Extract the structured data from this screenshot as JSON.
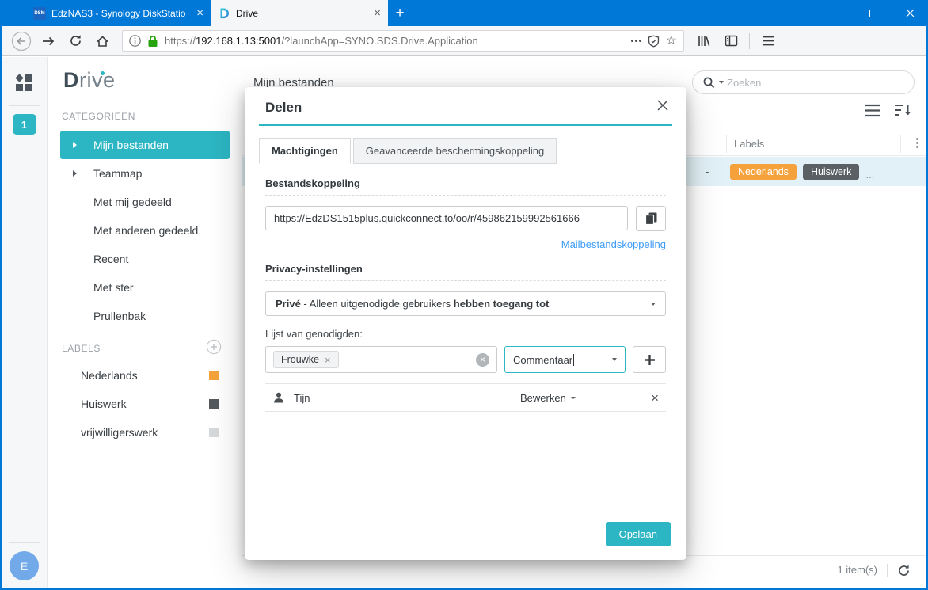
{
  "browser": {
    "tabs": [
      {
        "favicon_text": "DSM",
        "title": "EdzNAS3 - Synology DiskStatio",
        "close": "×"
      },
      {
        "title": "Drive",
        "close": "×"
      }
    ],
    "new_tab_label": "+",
    "url": {
      "scheme": "https://",
      "host": "192.168.1.13:5001",
      "path": "/?launchApp=SYNO.SDS.Drive.Application"
    }
  },
  "rail": {
    "badge_count": "1",
    "avatar_initial": "E"
  },
  "sidebar": {
    "logo_d": "D",
    "logo_rest": "rive",
    "categories_header": "CATEGORIEËN",
    "items": [
      {
        "label": "Mijn bestanden"
      },
      {
        "label": "Teammap"
      },
      {
        "label": "Met mij gedeeld"
      },
      {
        "label": "Met anderen gedeeld"
      },
      {
        "label": "Recent"
      },
      {
        "label": "Met ster"
      },
      {
        "label": "Prullenbak"
      }
    ],
    "labels_header": "LABELS",
    "labels": [
      {
        "name": "Nederlands",
        "color": "#F5A23C"
      },
      {
        "name": "Huiswerk",
        "color": "#54595E"
      },
      {
        "name": "vrijwilligerswerk",
        "color": "#D6D9DB"
      }
    ]
  },
  "content": {
    "page_title": "Mijn bestanden",
    "search_placeholder": "Zoeken",
    "table": {
      "labels_column_header": "Labels",
      "row": {
        "dash": "-",
        "tags": [
          {
            "name": "Nederlands",
            "bg": "#F5A23C"
          },
          {
            "name": "Huiswerk",
            "bg": "#5B6064"
          }
        ],
        "ellipsis": "..."
      }
    },
    "status_count": "1 item(s)"
  },
  "dialog": {
    "title": "Delen",
    "tabs": [
      {
        "label": "Machtigingen"
      },
      {
        "label": "Geavanceerde beschermingskoppeling"
      }
    ],
    "file_link": {
      "section_title": "Bestandskoppeling",
      "value": "https://EdzDS1515plus.quickconnect.to/oo/r/459862159992561666",
      "mail_link_label": "Mailbestandskoppeling"
    },
    "privacy": {
      "section_title": "Privacy-instellingen",
      "value_bold_start": "Privé",
      "value_middle": " - Alleen uitgenodigde gebruikers ",
      "value_bold_end": "hebben toegang tot"
    },
    "invitees": {
      "label": "Lijst van genodigden:",
      "chip_name": "Frouwke",
      "chip_close": "×",
      "comment_combo_value": "Commentaar",
      "member": {
        "name": "Tijn",
        "permission": "Bewerken",
        "remove": "×"
      }
    },
    "save_label": "Opslaan"
  },
  "colors": {
    "accent": "#2CB5C2",
    "titlebar": "#0078D7",
    "link": "#3C9BF5"
  }
}
